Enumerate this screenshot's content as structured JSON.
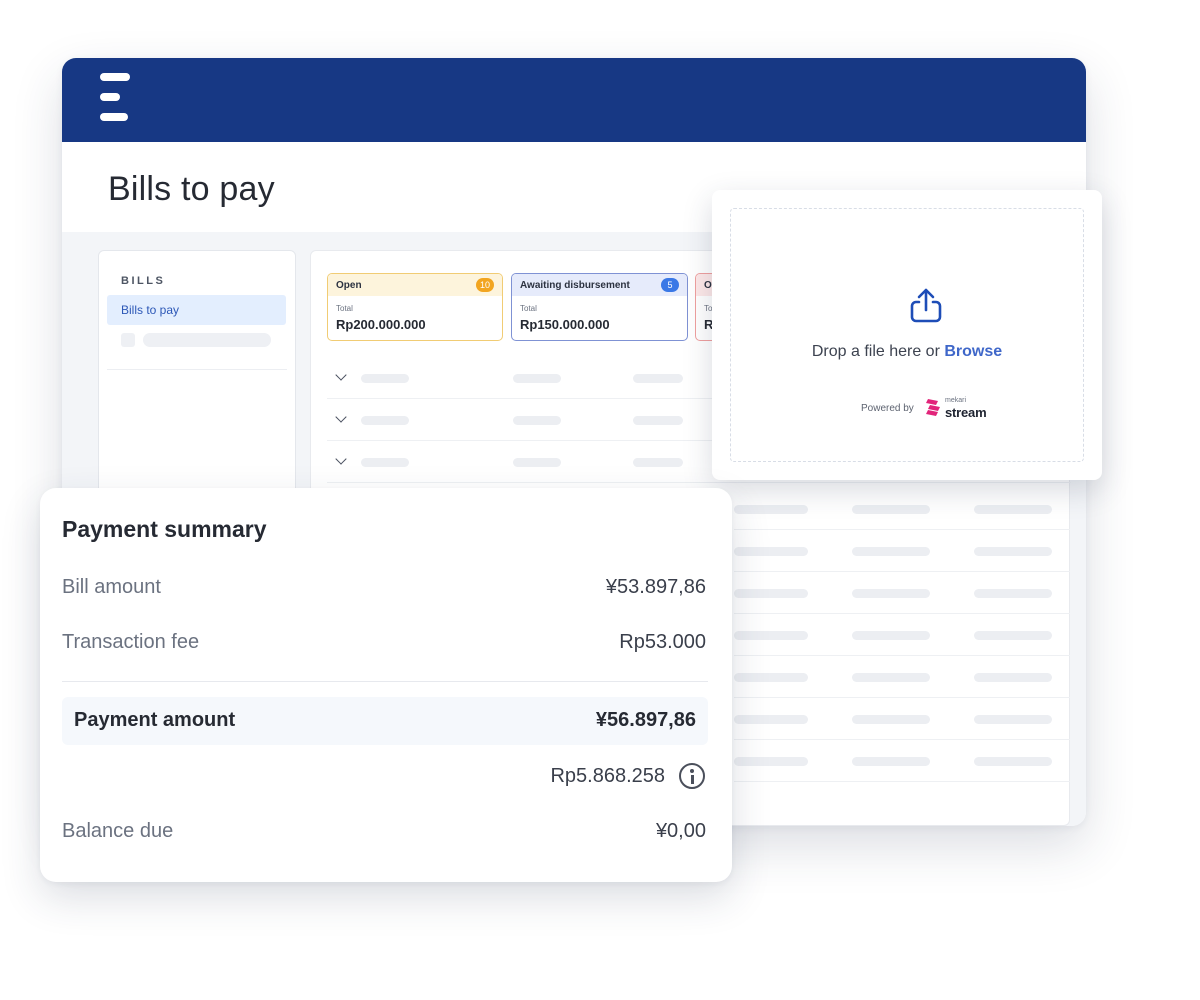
{
  "header": {
    "page_title": "Bills to pay"
  },
  "sidebar": {
    "heading": "BILLS",
    "items": [
      {
        "label": "Bills to pay",
        "active": true
      }
    ]
  },
  "cards": [
    {
      "label": "Open",
      "badge": "10",
      "sub": "Total",
      "value": "Rp200.000.000",
      "accent": "#f2a520"
    },
    {
      "label": "Awaiting disbursement",
      "badge": "5",
      "sub": "Total",
      "value": "Rp150.000.000",
      "accent": "#3a78e6"
    },
    {
      "label": "Ov",
      "sub": "To",
      "value": "R"
    }
  ],
  "upload": {
    "icon": "upload-icon",
    "prompt": "Drop a file here or ",
    "browse": "Browse",
    "powered_by": "Powered by",
    "brand_small": "mekari",
    "brand_name": "stream"
  },
  "summary": {
    "title": "Payment summary",
    "bill_amount_label": "Bill amount",
    "bill_amount_value": "¥53.897,86",
    "fee_label": "Transaction fee",
    "fee_value": "Rp53.000",
    "payment_label": "Payment amount",
    "payment_value": "¥56.897,86",
    "converted_value": "Rp5.868.258",
    "balance_label": "Balance due",
    "balance_value": "¥0,00"
  },
  "colors": {
    "topbar": "#173884",
    "accent_link": "#3f67c9",
    "active_item": "#2d58b7"
  }
}
